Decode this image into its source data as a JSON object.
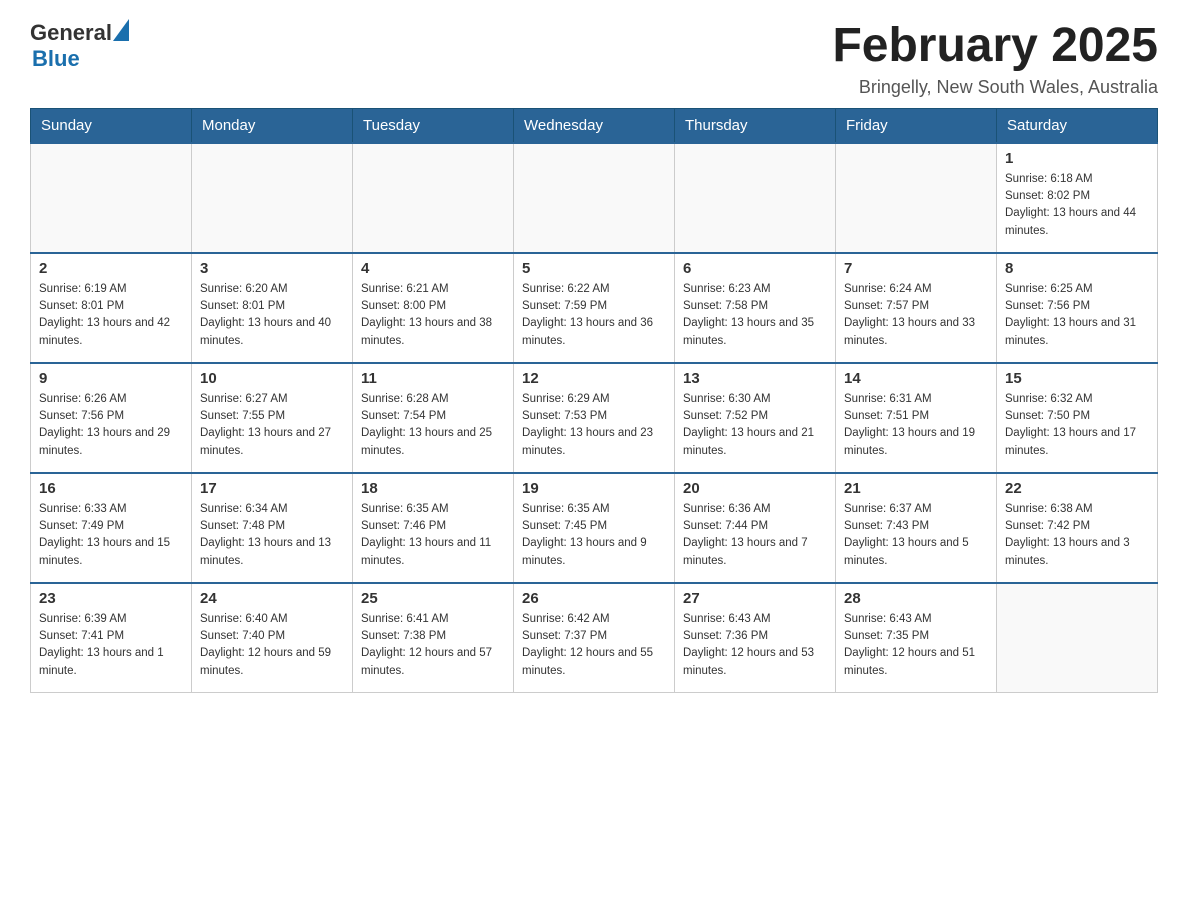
{
  "header": {
    "logo_general": "General",
    "logo_blue": "Blue",
    "month_title": "February 2025",
    "location": "Bringelly, New South Wales, Australia"
  },
  "days_of_week": [
    "Sunday",
    "Monday",
    "Tuesday",
    "Wednesday",
    "Thursday",
    "Friday",
    "Saturday"
  ],
  "weeks": [
    {
      "days": [
        {
          "number": "",
          "info": ""
        },
        {
          "number": "",
          "info": ""
        },
        {
          "number": "",
          "info": ""
        },
        {
          "number": "",
          "info": ""
        },
        {
          "number": "",
          "info": ""
        },
        {
          "number": "",
          "info": ""
        },
        {
          "number": "1",
          "info": "Sunrise: 6:18 AM\nSunset: 8:02 PM\nDaylight: 13 hours and 44 minutes."
        }
      ]
    },
    {
      "days": [
        {
          "number": "2",
          "info": "Sunrise: 6:19 AM\nSunset: 8:01 PM\nDaylight: 13 hours and 42 minutes."
        },
        {
          "number": "3",
          "info": "Sunrise: 6:20 AM\nSunset: 8:01 PM\nDaylight: 13 hours and 40 minutes."
        },
        {
          "number": "4",
          "info": "Sunrise: 6:21 AM\nSunset: 8:00 PM\nDaylight: 13 hours and 38 minutes."
        },
        {
          "number": "5",
          "info": "Sunrise: 6:22 AM\nSunset: 7:59 PM\nDaylight: 13 hours and 36 minutes."
        },
        {
          "number": "6",
          "info": "Sunrise: 6:23 AM\nSunset: 7:58 PM\nDaylight: 13 hours and 35 minutes."
        },
        {
          "number": "7",
          "info": "Sunrise: 6:24 AM\nSunset: 7:57 PM\nDaylight: 13 hours and 33 minutes."
        },
        {
          "number": "8",
          "info": "Sunrise: 6:25 AM\nSunset: 7:56 PM\nDaylight: 13 hours and 31 minutes."
        }
      ]
    },
    {
      "days": [
        {
          "number": "9",
          "info": "Sunrise: 6:26 AM\nSunset: 7:56 PM\nDaylight: 13 hours and 29 minutes."
        },
        {
          "number": "10",
          "info": "Sunrise: 6:27 AM\nSunset: 7:55 PM\nDaylight: 13 hours and 27 minutes."
        },
        {
          "number": "11",
          "info": "Sunrise: 6:28 AM\nSunset: 7:54 PM\nDaylight: 13 hours and 25 minutes."
        },
        {
          "number": "12",
          "info": "Sunrise: 6:29 AM\nSunset: 7:53 PM\nDaylight: 13 hours and 23 minutes."
        },
        {
          "number": "13",
          "info": "Sunrise: 6:30 AM\nSunset: 7:52 PM\nDaylight: 13 hours and 21 minutes."
        },
        {
          "number": "14",
          "info": "Sunrise: 6:31 AM\nSunset: 7:51 PM\nDaylight: 13 hours and 19 minutes."
        },
        {
          "number": "15",
          "info": "Sunrise: 6:32 AM\nSunset: 7:50 PM\nDaylight: 13 hours and 17 minutes."
        }
      ]
    },
    {
      "days": [
        {
          "number": "16",
          "info": "Sunrise: 6:33 AM\nSunset: 7:49 PM\nDaylight: 13 hours and 15 minutes."
        },
        {
          "number": "17",
          "info": "Sunrise: 6:34 AM\nSunset: 7:48 PM\nDaylight: 13 hours and 13 minutes."
        },
        {
          "number": "18",
          "info": "Sunrise: 6:35 AM\nSunset: 7:46 PM\nDaylight: 13 hours and 11 minutes."
        },
        {
          "number": "19",
          "info": "Sunrise: 6:35 AM\nSunset: 7:45 PM\nDaylight: 13 hours and 9 minutes."
        },
        {
          "number": "20",
          "info": "Sunrise: 6:36 AM\nSunset: 7:44 PM\nDaylight: 13 hours and 7 minutes."
        },
        {
          "number": "21",
          "info": "Sunrise: 6:37 AM\nSunset: 7:43 PM\nDaylight: 13 hours and 5 minutes."
        },
        {
          "number": "22",
          "info": "Sunrise: 6:38 AM\nSunset: 7:42 PM\nDaylight: 13 hours and 3 minutes."
        }
      ]
    },
    {
      "days": [
        {
          "number": "23",
          "info": "Sunrise: 6:39 AM\nSunset: 7:41 PM\nDaylight: 13 hours and 1 minute."
        },
        {
          "number": "24",
          "info": "Sunrise: 6:40 AM\nSunset: 7:40 PM\nDaylight: 12 hours and 59 minutes."
        },
        {
          "number": "25",
          "info": "Sunrise: 6:41 AM\nSunset: 7:38 PM\nDaylight: 12 hours and 57 minutes."
        },
        {
          "number": "26",
          "info": "Sunrise: 6:42 AM\nSunset: 7:37 PM\nDaylight: 12 hours and 55 minutes."
        },
        {
          "number": "27",
          "info": "Sunrise: 6:43 AM\nSunset: 7:36 PM\nDaylight: 12 hours and 53 minutes."
        },
        {
          "number": "28",
          "info": "Sunrise: 6:43 AM\nSunset: 7:35 PM\nDaylight: 12 hours and 51 minutes."
        },
        {
          "number": "",
          "info": ""
        }
      ]
    }
  ]
}
